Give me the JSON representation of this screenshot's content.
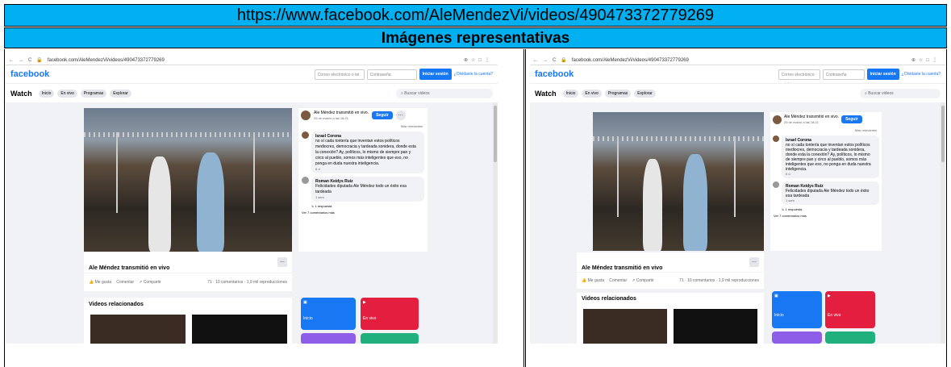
{
  "header": {
    "url": "https://www.facebook.com/AleMendezVi/videos/490473372779269",
    "subtitle": "Imágenes representativas"
  },
  "screenshot": {
    "browser_url": "facebook.com/AleMendezVi/videos/490473372779269",
    "logo": "facebook",
    "email_placeholder": "Correo electrónico o tel",
    "password_placeholder": "Contraseña",
    "login_label": "Iniciar sesión",
    "forgot_label": "¿Olvidaste la cuenta?",
    "watch_title": "Watch",
    "nav": [
      "Inicio",
      "En vivo",
      "Programas",
      "Explorar"
    ],
    "search_placeholder": "Buscar videos",
    "author_line": "Ale Méndez transmitió en vivo.",
    "date": "25 de marzo a las 18:21",
    "follow_label": "Seguir",
    "relevance": "Más relevantes",
    "comment1": {
      "name": "Israel Corona",
      "text": "no sí cada tontería que inventan estos políticos mediocres, democracia y tardeada sonidera, donde esta la conexión? Ay, políticos, lo mismo de siempre pan y circo al pueblo, somos más inteligentes que eso, no ponga en duda nuestra inteligencia.",
      "time": "6 d"
    },
    "comment2": {
      "name": "Roman Keidys Ruiz",
      "text": "Felicidades diputada Ale Méndez todo un éxito esa tardeada",
      "time": "1 sem"
    },
    "reply_label": "1 respuesta",
    "more_comments": "Ver 7 comentarios más",
    "video_title": "Ale Méndez transmitió en vivo",
    "like": "Me gusta",
    "comment": "Comentar",
    "share": "Compartir",
    "stats": "71 · 10 comentarios · 1,9 mil reproducciones",
    "related_title": "Videos relacionados",
    "tile1": "Inicio",
    "tile2": "En vivo"
  }
}
